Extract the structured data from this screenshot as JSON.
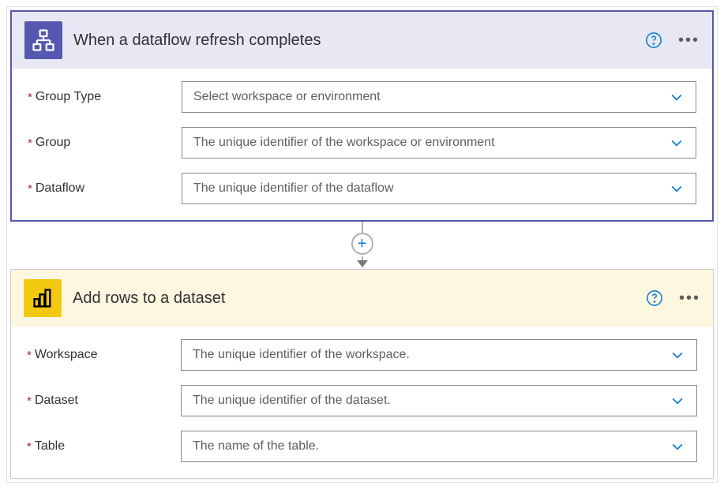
{
  "trigger": {
    "title": "When a dataflow refresh completes",
    "fields": [
      {
        "label": "Group Type",
        "placeholder": "Select workspace or environment"
      },
      {
        "label": "Group",
        "placeholder": "The unique identifier of the workspace or environment"
      },
      {
        "label": "Dataflow",
        "placeholder": "The unique identifier of the dataflow"
      }
    ]
  },
  "action": {
    "title": "Add rows to a dataset",
    "fields": [
      {
        "label": "Workspace",
        "placeholder": "The unique identifier of the workspace."
      },
      {
        "label": "Dataset",
        "placeholder": "The unique identifier of the dataset."
      },
      {
        "label": "Table",
        "placeholder": "The name of the table."
      }
    ]
  }
}
